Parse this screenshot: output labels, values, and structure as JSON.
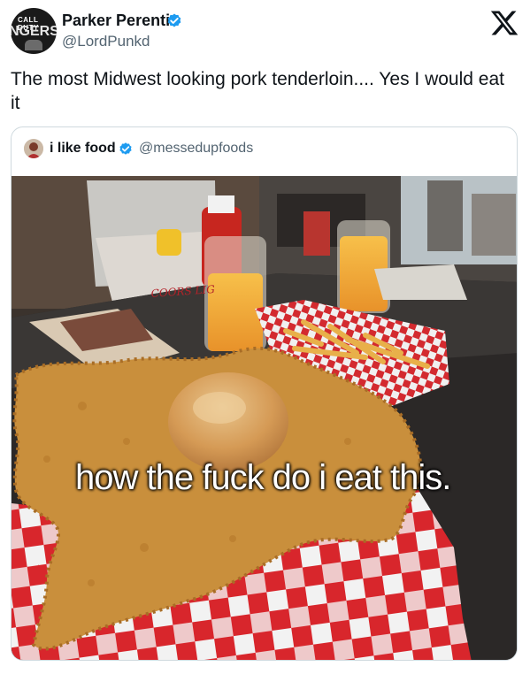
{
  "author": {
    "name": "Parker Perentis",
    "handle": "@LordPunkd",
    "avatar_text_top": "CALL DUTY",
    "avatar_text_main": "NGERS"
  },
  "post_text": "The most Midwest looking pork tenderloin.... Yes I would eat it",
  "quoted": {
    "name": "i like food",
    "handle": "@messedupfoods",
    "caption": "how the fuck do i eat this.",
    "basket_text": "COORS LIG"
  },
  "icons": {
    "verified": "verified-badge-icon",
    "brand": "x-logo-icon"
  },
  "colors": {
    "verified": "#1d9bf0",
    "handle": "#536471",
    "border": "#cfd9de"
  }
}
